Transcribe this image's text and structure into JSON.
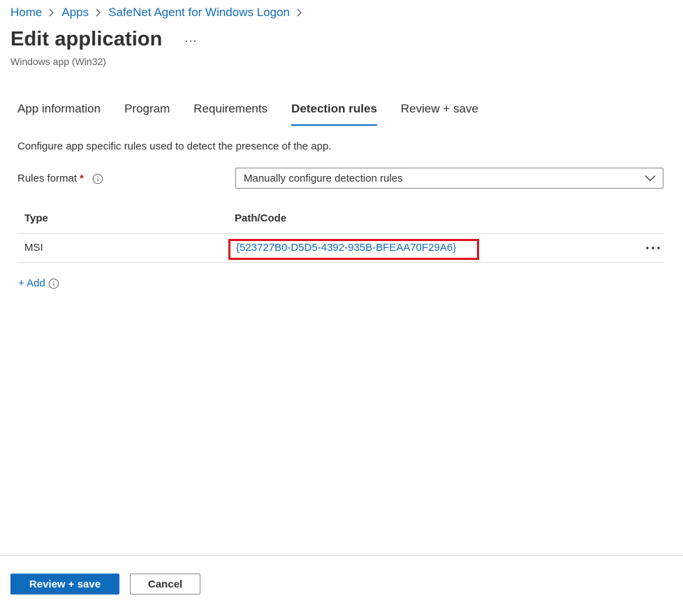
{
  "breadcrumb": {
    "items": [
      "Home",
      "Apps",
      "SafeNet Agent for Windows Logon"
    ]
  },
  "header": {
    "title": "Edit application",
    "subtitle": "Windows app (Win32)",
    "more_icon": "ellipsis-icon"
  },
  "tabs": [
    {
      "label": "App information",
      "active": false
    },
    {
      "label": "Program",
      "active": false
    },
    {
      "label": "Requirements",
      "active": false
    },
    {
      "label": "Detection rules",
      "active": true
    },
    {
      "label": "Review + save",
      "active": false
    }
  ],
  "main": {
    "description": "Configure app specific rules used to detect the presence of the app.",
    "rules_format": {
      "label": "Rules format",
      "required_mark": "*",
      "value": "Manually configure detection rules"
    },
    "table": {
      "headers": [
        "Type",
        "Path/Code"
      ],
      "rows": [
        {
          "type": "MSI",
          "path_code": "{523727B0-D5D5-4392-935B-BFEAA70F29A6}"
        }
      ]
    },
    "add_label": "+ Add"
  },
  "footer": {
    "primary_label": "Review + save",
    "secondary_label": "Cancel"
  },
  "colors": {
    "accent": "#0f6cbd",
    "highlight": "#e0101c",
    "required": "#a4262c"
  }
}
